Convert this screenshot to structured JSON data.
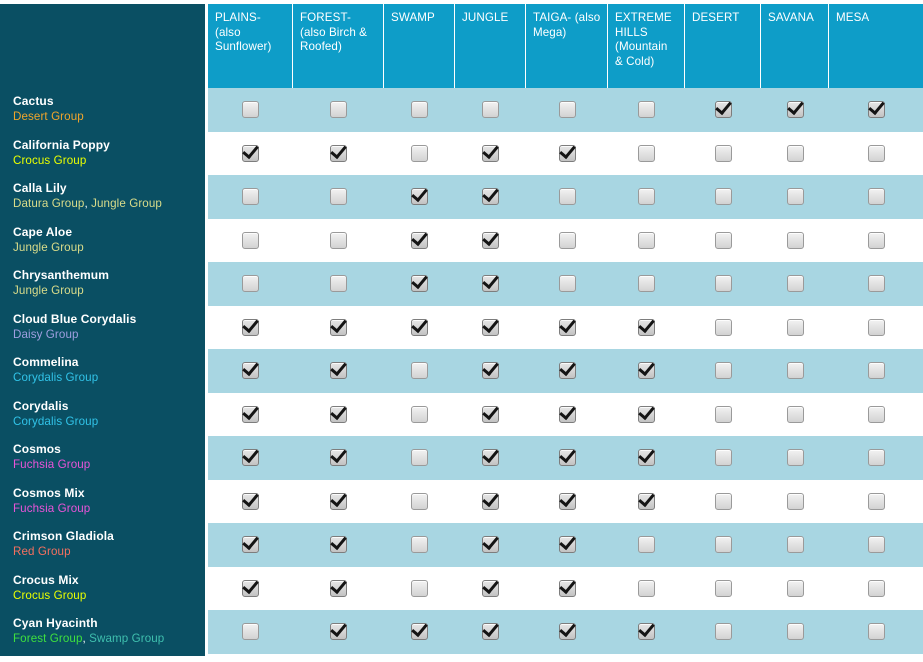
{
  "table": {
    "corner_header": "",
    "columns": [
      {
        "id": "plains",
        "label": "PLAINS- (also Sunflower)",
        "width": 85
      },
      {
        "id": "forest",
        "label": "FOREST- (also Birch & Roofed)",
        "width": 91
      },
      {
        "id": "swamp",
        "label": "SWAMP",
        "width": 71
      },
      {
        "id": "jungle",
        "label": "JUNGLE",
        "width": 71
      },
      {
        "id": "taiga",
        "label": "TAIGA- (also Mega)",
        "width": 82
      },
      {
        "id": "extreme_hills",
        "label": "EXTREME HILLS (Mountain & Cold)",
        "width": 77
      },
      {
        "id": "desert",
        "label": "DESERT",
        "width": 76
      },
      {
        "id": "savana",
        "label": "SAVANA",
        "width": 68
      },
      {
        "id": "mesa",
        "label": "MESA",
        "width": 94
      }
    ],
    "group_colors": {
      "Desert Group": "#f0a52b",
      "Crocus Group": "#eaff00",
      "Datura Group": "#d9dc8a",
      "Jungle Group": "#d9dc8a",
      "Daisy Group": "#9f9fe0",
      "Corydalis Group": "#31c3e8",
      "Fuchsia Group": "#e954d8",
      "Red Group": "#f4705f",
      "Forest Group": "#3ee03e",
      "Swamp Group": "#3fbfae"
    },
    "rows": [
      {
        "name": "Cactus",
        "groups": [
          {
            "label": "Desert Group",
            "color": "#f0a52b"
          }
        ],
        "checks": [
          false,
          false,
          false,
          false,
          false,
          false,
          true,
          true,
          true
        ]
      },
      {
        "name": "California Poppy",
        "groups": [
          {
            "label": "Crocus Group",
            "color": "#eaff00"
          }
        ],
        "checks": [
          true,
          true,
          false,
          true,
          true,
          false,
          false,
          false,
          false
        ]
      },
      {
        "name": "Calla Lily",
        "groups": [
          {
            "label": "Datura Group",
            "color": "#d9dc8a"
          },
          {
            "label": "Jungle Group",
            "color": "#d9dc8a"
          }
        ],
        "checks": [
          false,
          false,
          true,
          true,
          false,
          false,
          false,
          false,
          false
        ]
      },
      {
        "name": "Cape Aloe",
        "groups": [
          {
            "label": "Jungle Group",
            "color": "#d9dc8a"
          }
        ],
        "checks": [
          false,
          false,
          true,
          true,
          false,
          false,
          false,
          false,
          false
        ]
      },
      {
        "name": "Chrysanthemum",
        "groups": [
          {
            "label": "Jungle Group",
            "color": "#d9dc8a"
          }
        ],
        "checks": [
          false,
          false,
          true,
          true,
          false,
          false,
          false,
          false,
          false
        ]
      },
      {
        "name": "Cloud Blue Corydalis",
        "groups": [
          {
            "label": "Daisy Group",
            "color": "#9f9fe0"
          }
        ],
        "checks": [
          true,
          true,
          true,
          true,
          true,
          true,
          false,
          false,
          false
        ]
      },
      {
        "name": "Commelina",
        "groups": [
          {
            "label": "Corydalis Group",
            "color": "#31c3e8"
          }
        ],
        "checks": [
          true,
          true,
          false,
          true,
          true,
          true,
          false,
          false,
          false
        ]
      },
      {
        "name": "Corydalis",
        "groups": [
          {
            "label": "Corydalis Group",
            "color": "#31c3e8"
          }
        ],
        "checks": [
          true,
          true,
          false,
          true,
          true,
          true,
          false,
          false,
          false
        ]
      },
      {
        "name": "Cosmos",
        "groups": [
          {
            "label": "Fuchsia Group",
            "color": "#e954d8"
          }
        ],
        "checks": [
          true,
          true,
          false,
          true,
          true,
          true,
          false,
          false,
          false
        ]
      },
      {
        "name": "Cosmos Mix",
        "groups": [
          {
            "label": "Fuchsia Group",
            "color": "#e954d8"
          }
        ],
        "checks": [
          true,
          true,
          false,
          true,
          true,
          true,
          false,
          false,
          false
        ]
      },
      {
        "name": "Crimson Gladiola",
        "groups": [
          {
            "label": "Red Group",
            "color": "#f4705f"
          }
        ],
        "checks": [
          true,
          true,
          false,
          true,
          true,
          false,
          false,
          false,
          false
        ]
      },
      {
        "name": "Crocus Mix",
        "groups": [
          {
            "label": "Crocus Group",
            "color": "#eaff00"
          }
        ],
        "checks": [
          true,
          true,
          false,
          true,
          true,
          false,
          false,
          false,
          false
        ]
      },
      {
        "name": "Cyan Hyacinth",
        "groups": [
          {
            "label": "Forest Group",
            "color": "#3ee03e"
          },
          {
            "label": "Swamp Group",
            "color": "#3fbfae"
          }
        ],
        "checks": [
          false,
          true,
          true,
          true,
          true,
          true,
          false,
          false,
          false
        ]
      }
    ],
    "theme": {
      "header_bg": "#0e9dc8",
      "sidebar_bg": "#0a4f63",
      "row_odd_bg": "#a8d6e2",
      "row_even_bg": "#ffffff",
      "page_bg": "#ffffff"
    }
  }
}
